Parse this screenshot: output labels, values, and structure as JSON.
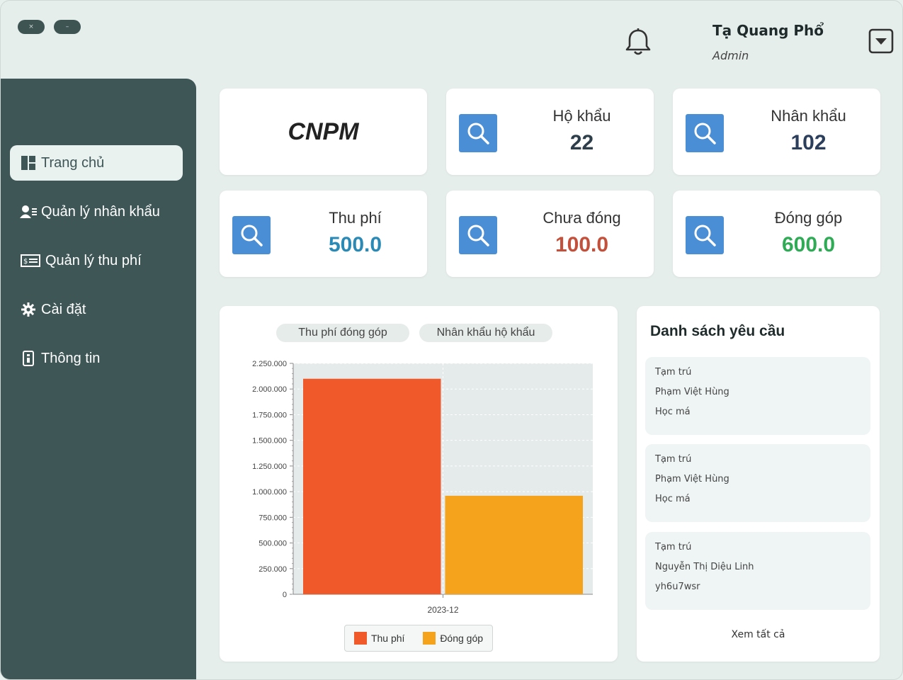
{
  "window": {
    "close_glyph": "×",
    "minimize_glyph": "–"
  },
  "header": {
    "user_name": "Tạ Quang Phổ",
    "user_role": "Admin",
    "icons": {
      "bell": "bell-icon",
      "menu": "dropdown-icon"
    }
  },
  "sidebar": {
    "items": [
      {
        "label": "Trang chủ",
        "icon": "dashboard-icon",
        "active": true
      },
      {
        "label": "Quản lý nhân khẩu",
        "icon": "users-icon",
        "active": false
      },
      {
        "label": "Quản lý thu phí",
        "icon": "money-icon",
        "active": false
      },
      {
        "label": "Cài đặt",
        "icon": "gear-icon",
        "active": false
      },
      {
        "label": "Thông tin",
        "icon": "info-icon",
        "active": false
      }
    ]
  },
  "brand": {
    "text": "CNPM"
  },
  "stats": [
    {
      "label": "Hộ khẩu",
      "value": "22",
      "color": "#2d3e4a",
      "icon": "search-icon"
    },
    {
      "label": "Nhân khẩu",
      "value": "102",
      "color": "#2b3f5c",
      "icon": "search-icon"
    },
    {
      "label": "Thu phí",
      "value": "500.0",
      "color": "#2a8ab5",
      "icon": "search-icon"
    },
    {
      "label": "Chưa đóng",
      "value": "100.0",
      "color": "#c2503a",
      "icon": "search-icon"
    },
    {
      "label": "Đóng góp",
      "value": "600.0",
      "color": "#2faa55",
      "icon": "search-icon"
    }
  ],
  "chart_tabs": [
    "Thu phí đóng góp",
    "Nhân khẩu hộ khẩu"
  ],
  "chart_data": {
    "type": "bar",
    "categories": [
      "2023-12"
    ],
    "series": [
      {
        "name": "Thu phí",
        "values": [
          2100000
        ],
        "color": "#f05a2a"
      },
      {
        "name": "Đóng góp",
        "values": [
          960000
        ],
        "color": "#f5a31c"
      }
    ],
    "ylim": [
      0,
      2250000
    ],
    "yticks": [
      0,
      250000,
      500000,
      750000,
      1000000,
      1250000,
      1500000,
      1750000,
      2000000,
      2250000
    ],
    "ytick_labels": [
      "0",
      "250.000",
      "500.000",
      "750.000",
      "1.000.000",
      "1.250.000",
      "1.500.000",
      "1.750.000",
      "2.000.000",
      "2.250.000"
    ],
    "grid": true,
    "legend": "bottom-center"
  },
  "requests": {
    "title": "Danh sách yêu cầu",
    "items": [
      {
        "type": "Tạm trú",
        "name": "Phạm Việt Hùng",
        "note": "Học má"
      },
      {
        "type": "Tạm trú",
        "name": "Phạm Việt Hùng",
        "note": "Học má"
      },
      {
        "type": "Tạm trú",
        "name": "Nguyễn Thị Diệu Linh",
        "note": "yh6u7wsr"
      }
    ],
    "see_all": "Xem tất cả"
  }
}
